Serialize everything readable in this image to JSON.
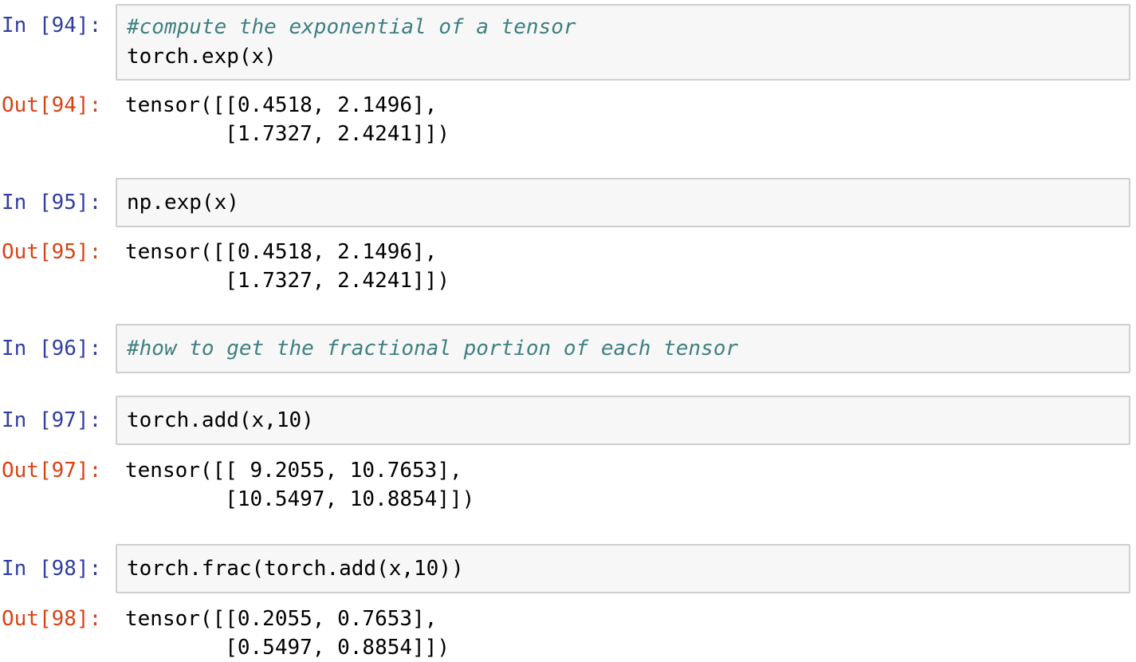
{
  "cells": [
    {
      "in_prompt": "In [94]:",
      "input_lines": [
        {
          "text": "#compute the exponential of a tensor",
          "kind": "comment"
        },
        {
          "text": "torch.exp(x)",
          "kind": "code"
        }
      ],
      "out_prompt": "Out[94]:",
      "output_lines": [
        "tensor([[0.4518, 2.1496],",
        "        [1.7327, 2.4241]])"
      ]
    },
    {
      "in_prompt": "In [95]:",
      "input_lines": [
        {
          "text": "np.exp(x)",
          "kind": "code"
        }
      ],
      "out_prompt": "Out[95]:",
      "output_lines": [
        "tensor([[0.4518, 2.1496],",
        "        [1.7327, 2.4241]])"
      ]
    },
    {
      "in_prompt": "In [96]:",
      "input_lines": [
        {
          "text": "#how to get the fractional portion of each tensor",
          "kind": "comment"
        }
      ]
    },
    {
      "in_prompt": "In [97]:",
      "input_lines": [
        {
          "text": "torch.add(x,10)",
          "kind": "code"
        }
      ],
      "out_prompt": "Out[97]:",
      "output_lines": [
        "tensor([[ 9.2055, 10.7653],",
        "        [10.5497, 10.8854]])"
      ]
    },
    {
      "in_prompt": "In [98]:",
      "input_lines": [
        {
          "text": "torch.frac(torch.add(x,10))",
          "kind": "code"
        }
      ],
      "out_prompt": "Out[98]:",
      "output_lines": [
        "tensor([[0.2055, 0.7653],",
        "        [0.5497, 0.8854]])"
      ]
    }
  ]
}
